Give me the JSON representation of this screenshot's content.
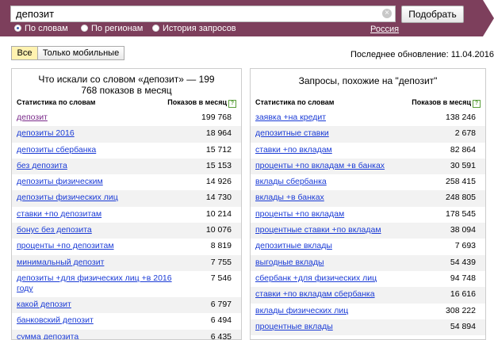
{
  "search": {
    "query": "депозит",
    "button": "Подобрать",
    "clear_glyph": "×"
  },
  "modes": [
    {
      "label": "По словам",
      "selected": true
    },
    {
      "label": "По регионам",
      "selected": false
    },
    {
      "label": "История запросов",
      "selected": false
    }
  ],
  "region": "Россия",
  "filters": {
    "all": "Все",
    "mobile": "Только мобильные"
  },
  "last_update": "Последнее обновление: 11.04.2016",
  "left_panel": {
    "title": "Что искали со словом «депозит» — 199 768 показов в месяц",
    "col_keyword": "Статистика по словам",
    "col_shows": "Показов в месяц",
    "rows": [
      {
        "keyword": "депозит",
        "count": "199 768"
      },
      {
        "keyword": "депозиты 2016",
        "count": "18 964"
      },
      {
        "keyword": "депозиты сбербанка",
        "count": "15 712"
      },
      {
        "keyword": "без депозита",
        "count": "15 153"
      },
      {
        "keyword": "депозиты физическим",
        "count": "14 926"
      },
      {
        "keyword": "депозиты физических лиц",
        "count": "14 730"
      },
      {
        "keyword": "ставки +по депозитам",
        "count": "10 214"
      },
      {
        "keyword": "бонус без депозита",
        "count": "10 076"
      },
      {
        "keyword": "проценты +по депозитам",
        "count": "8 819"
      },
      {
        "keyword": "минимальный депозит",
        "count": "7 755"
      },
      {
        "keyword": "депозиты +для физических лиц +в 2016 году",
        "count": "7 546"
      },
      {
        "keyword": "какой депозит",
        "count": "6 797"
      },
      {
        "keyword": "банковский депозит",
        "count": "6 494"
      },
      {
        "keyword": "сумма депозита",
        "count": "6 435"
      }
    ]
  },
  "right_panel": {
    "title": "Запросы, похожие на \"депозит\"",
    "col_keyword": "Статистика по словам",
    "col_shows": "Показов в месяц",
    "rows": [
      {
        "keyword": "заявка +на кредит",
        "count": "138 246"
      },
      {
        "keyword": "депозитные ставки",
        "count": "2 678"
      },
      {
        "keyword": "ставки +по вкладам",
        "count": "82 864"
      },
      {
        "keyword": "проценты +по вкладам +в банках",
        "count": "30 591"
      },
      {
        "keyword": "вклады сбербанка",
        "count": "258 415"
      },
      {
        "keyword": "вклады +в банках",
        "count": "248 805"
      },
      {
        "keyword": "проценты +по вкладам",
        "count": "178 545"
      },
      {
        "keyword": "процентные ставки +по вкладам",
        "count": "38 094"
      },
      {
        "keyword": "депозитные вклады",
        "count": "7 693"
      },
      {
        "keyword": "выгодные вклады",
        "count": "54 439"
      },
      {
        "keyword": "сбербанк +для физических лиц",
        "count": "94 748"
      },
      {
        "keyword": "ставки +по вкладам сбербанка",
        "count": "16 616"
      },
      {
        "keyword": "вклады физических лиц",
        "count": "308 222"
      },
      {
        "keyword": "процентные вклады",
        "count": "54 894"
      }
    ]
  }
}
